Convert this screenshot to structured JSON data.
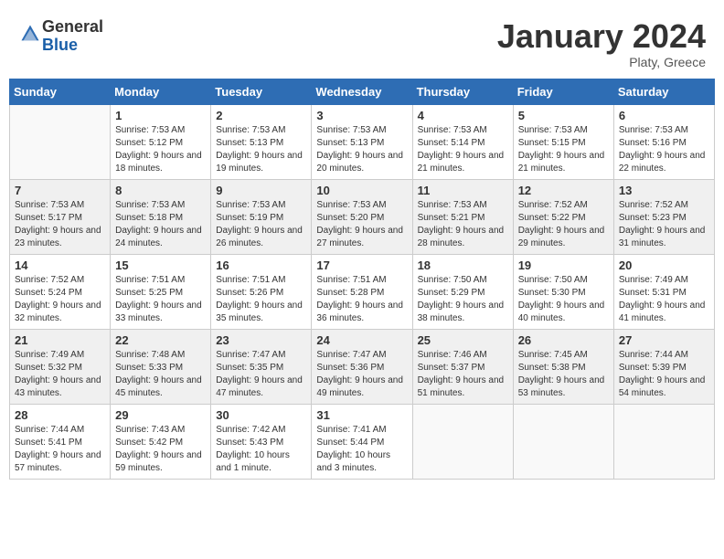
{
  "header": {
    "logo_general": "General",
    "logo_blue": "Blue",
    "month_title": "January 2024",
    "location": "Platy, Greece"
  },
  "days_of_week": [
    "Sunday",
    "Monday",
    "Tuesday",
    "Wednesday",
    "Thursday",
    "Friday",
    "Saturday"
  ],
  "weeks": [
    [
      {
        "day": "",
        "sunrise": "",
        "sunset": "",
        "daylight": ""
      },
      {
        "day": "1",
        "sunrise": "Sunrise: 7:53 AM",
        "sunset": "Sunset: 5:12 PM",
        "daylight": "Daylight: 9 hours and 18 minutes."
      },
      {
        "day": "2",
        "sunrise": "Sunrise: 7:53 AM",
        "sunset": "Sunset: 5:13 PM",
        "daylight": "Daylight: 9 hours and 19 minutes."
      },
      {
        "day": "3",
        "sunrise": "Sunrise: 7:53 AM",
        "sunset": "Sunset: 5:13 PM",
        "daylight": "Daylight: 9 hours and 20 minutes."
      },
      {
        "day": "4",
        "sunrise": "Sunrise: 7:53 AM",
        "sunset": "Sunset: 5:14 PM",
        "daylight": "Daylight: 9 hours and 21 minutes."
      },
      {
        "day": "5",
        "sunrise": "Sunrise: 7:53 AM",
        "sunset": "Sunset: 5:15 PM",
        "daylight": "Daylight: 9 hours and 21 minutes."
      },
      {
        "day": "6",
        "sunrise": "Sunrise: 7:53 AM",
        "sunset": "Sunset: 5:16 PM",
        "daylight": "Daylight: 9 hours and 22 minutes."
      }
    ],
    [
      {
        "day": "7",
        "sunrise": "Sunrise: 7:53 AM",
        "sunset": "Sunset: 5:17 PM",
        "daylight": "Daylight: 9 hours and 23 minutes."
      },
      {
        "day": "8",
        "sunrise": "Sunrise: 7:53 AM",
        "sunset": "Sunset: 5:18 PM",
        "daylight": "Daylight: 9 hours and 24 minutes."
      },
      {
        "day": "9",
        "sunrise": "Sunrise: 7:53 AM",
        "sunset": "Sunset: 5:19 PM",
        "daylight": "Daylight: 9 hours and 26 minutes."
      },
      {
        "day": "10",
        "sunrise": "Sunrise: 7:53 AM",
        "sunset": "Sunset: 5:20 PM",
        "daylight": "Daylight: 9 hours and 27 minutes."
      },
      {
        "day": "11",
        "sunrise": "Sunrise: 7:53 AM",
        "sunset": "Sunset: 5:21 PM",
        "daylight": "Daylight: 9 hours and 28 minutes."
      },
      {
        "day": "12",
        "sunrise": "Sunrise: 7:52 AM",
        "sunset": "Sunset: 5:22 PM",
        "daylight": "Daylight: 9 hours and 29 minutes."
      },
      {
        "day": "13",
        "sunrise": "Sunrise: 7:52 AM",
        "sunset": "Sunset: 5:23 PM",
        "daylight": "Daylight: 9 hours and 31 minutes."
      }
    ],
    [
      {
        "day": "14",
        "sunrise": "Sunrise: 7:52 AM",
        "sunset": "Sunset: 5:24 PM",
        "daylight": "Daylight: 9 hours and 32 minutes."
      },
      {
        "day": "15",
        "sunrise": "Sunrise: 7:51 AM",
        "sunset": "Sunset: 5:25 PM",
        "daylight": "Daylight: 9 hours and 33 minutes."
      },
      {
        "day": "16",
        "sunrise": "Sunrise: 7:51 AM",
        "sunset": "Sunset: 5:26 PM",
        "daylight": "Daylight: 9 hours and 35 minutes."
      },
      {
        "day": "17",
        "sunrise": "Sunrise: 7:51 AM",
        "sunset": "Sunset: 5:28 PM",
        "daylight": "Daylight: 9 hours and 36 minutes."
      },
      {
        "day": "18",
        "sunrise": "Sunrise: 7:50 AM",
        "sunset": "Sunset: 5:29 PM",
        "daylight": "Daylight: 9 hours and 38 minutes."
      },
      {
        "day": "19",
        "sunrise": "Sunrise: 7:50 AM",
        "sunset": "Sunset: 5:30 PM",
        "daylight": "Daylight: 9 hours and 40 minutes."
      },
      {
        "day": "20",
        "sunrise": "Sunrise: 7:49 AM",
        "sunset": "Sunset: 5:31 PM",
        "daylight": "Daylight: 9 hours and 41 minutes."
      }
    ],
    [
      {
        "day": "21",
        "sunrise": "Sunrise: 7:49 AM",
        "sunset": "Sunset: 5:32 PM",
        "daylight": "Daylight: 9 hours and 43 minutes."
      },
      {
        "day": "22",
        "sunrise": "Sunrise: 7:48 AM",
        "sunset": "Sunset: 5:33 PM",
        "daylight": "Daylight: 9 hours and 45 minutes."
      },
      {
        "day": "23",
        "sunrise": "Sunrise: 7:47 AM",
        "sunset": "Sunset: 5:35 PM",
        "daylight": "Daylight: 9 hours and 47 minutes."
      },
      {
        "day": "24",
        "sunrise": "Sunrise: 7:47 AM",
        "sunset": "Sunset: 5:36 PM",
        "daylight": "Daylight: 9 hours and 49 minutes."
      },
      {
        "day": "25",
        "sunrise": "Sunrise: 7:46 AM",
        "sunset": "Sunset: 5:37 PM",
        "daylight": "Daylight: 9 hours and 51 minutes."
      },
      {
        "day": "26",
        "sunrise": "Sunrise: 7:45 AM",
        "sunset": "Sunset: 5:38 PM",
        "daylight": "Daylight: 9 hours and 53 minutes."
      },
      {
        "day": "27",
        "sunrise": "Sunrise: 7:44 AM",
        "sunset": "Sunset: 5:39 PM",
        "daylight": "Daylight: 9 hours and 54 minutes."
      }
    ],
    [
      {
        "day": "28",
        "sunrise": "Sunrise: 7:44 AM",
        "sunset": "Sunset: 5:41 PM",
        "daylight": "Daylight: 9 hours and 57 minutes."
      },
      {
        "day": "29",
        "sunrise": "Sunrise: 7:43 AM",
        "sunset": "Sunset: 5:42 PM",
        "daylight": "Daylight: 9 hours and 59 minutes."
      },
      {
        "day": "30",
        "sunrise": "Sunrise: 7:42 AM",
        "sunset": "Sunset: 5:43 PM",
        "daylight": "Daylight: 10 hours and 1 minute."
      },
      {
        "day": "31",
        "sunrise": "Sunrise: 7:41 AM",
        "sunset": "Sunset: 5:44 PM",
        "daylight": "Daylight: 10 hours and 3 minutes."
      },
      {
        "day": "",
        "sunrise": "",
        "sunset": "",
        "daylight": ""
      },
      {
        "day": "",
        "sunrise": "",
        "sunset": "",
        "daylight": ""
      },
      {
        "day": "",
        "sunrise": "",
        "sunset": "",
        "daylight": ""
      }
    ]
  ]
}
